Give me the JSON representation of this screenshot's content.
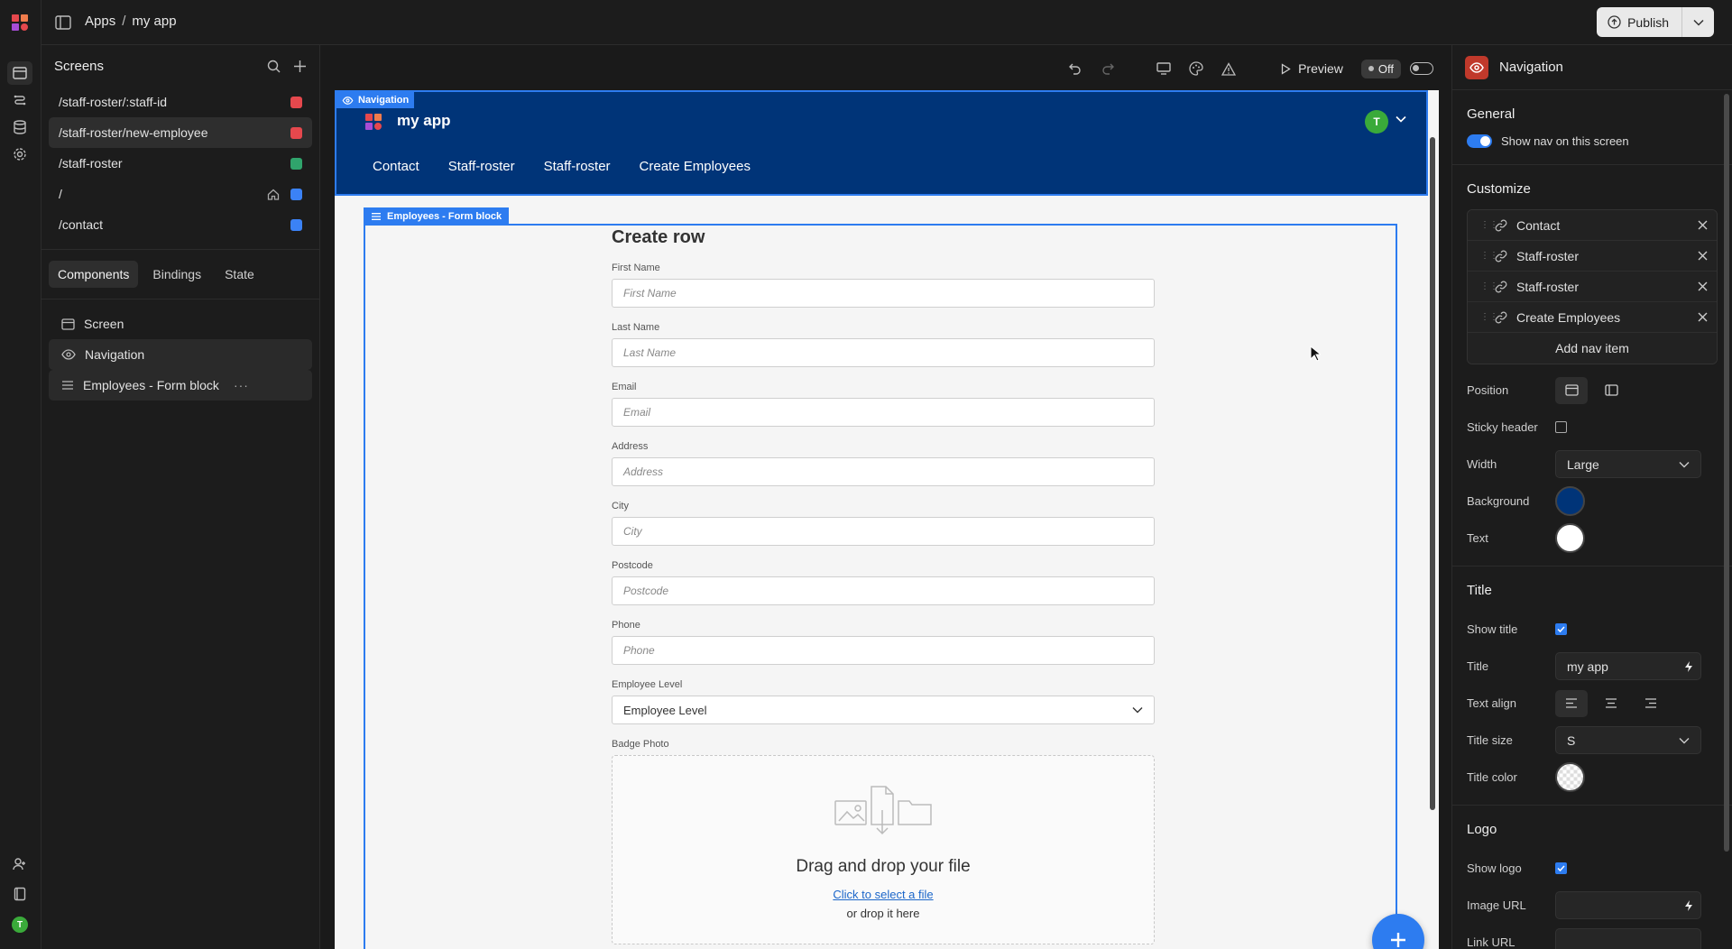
{
  "topbar": {
    "crumb_root": "Apps",
    "crumb_sep": "/",
    "crumb_app": "my app",
    "publish_label": "Publish"
  },
  "screens_panel": {
    "title": "Screens",
    "screens": [
      {
        "route": "/staff-roster/:staff-id",
        "color": "#e5484d",
        "selected": false,
        "home": false
      },
      {
        "route": "/staff-roster/new-employee",
        "color": "#e5484d",
        "selected": true,
        "home": false
      },
      {
        "route": "/staff-roster",
        "color": "#30a46c",
        "selected": false,
        "home": false
      },
      {
        "route": "/",
        "color": "#3b82f6",
        "selected": false,
        "home": true
      },
      {
        "route": "/contact",
        "color": "#3b82f6",
        "selected": false,
        "home": false
      }
    ],
    "tabs": [
      "Components",
      "Bindings",
      "State"
    ],
    "active_tab": "Components",
    "tree": [
      {
        "label": "Screen",
        "icon": "screen-icon"
      },
      {
        "label": "Navigation",
        "icon": "eye-icon"
      },
      {
        "label": "Employees - Form block",
        "icon": "form-icon"
      }
    ]
  },
  "canvas_toolbar": {
    "preview_label": "Preview",
    "off_label": "Off"
  },
  "preview": {
    "nav_tag": "Navigation",
    "app_title": "my app",
    "avatar_initial": "T",
    "nav_links": [
      "Contact",
      "Staff-roster",
      "Staff-roster",
      "Create Employees"
    ],
    "nav_background": "#003478",
    "form_tag": "Employees - Form block",
    "form_title": "Create row",
    "fields": [
      {
        "label": "First Name",
        "placeholder": "First Name"
      },
      {
        "label": "Last Name",
        "placeholder": "Last Name"
      },
      {
        "label": "Email",
        "placeholder": "Email"
      },
      {
        "label": "Address",
        "placeholder": "Address"
      },
      {
        "label": "City",
        "placeholder": "City"
      },
      {
        "label": "Postcode",
        "placeholder": "Postcode"
      },
      {
        "label": "Phone",
        "placeholder": "Phone"
      }
    ],
    "select_field": {
      "label": "Employee Level",
      "value": "Employee Level"
    },
    "upload_field": {
      "label": "Badge Photo",
      "title": "Drag and drop your file",
      "link": "Click to select a file",
      "or_text": "or drop it here"
    }
  },
  "settings_panel": {
    "title": "Navigation",
    "general": {
      "heading": "General",
      "show_nav_label": "Show nav on this screen",
      "show_nav_on": true
    },
    "customize": {
      "heading": "Customize",
      "nav_items": [
        "Contact",
        "Staff-roster",
        "Staff-roster",
        "Create Employees"
      ],
      "add_label": "Add nav item",
      "position_label": "Position",
      "sticky_label": "Sticky header",
      "sticky_on": false,
      "width_label": "Width",
      "width_value": "Large",
      "background_label": "Background",
      "background_color": "#003478",
      "text_label": "Text",
      "text_color": "#ffffff"
    },
    "title_section": {
      "heading": "Title",
      "show_title_label": "Show title",
      "show_title_on": true,
      "title_label": "Title",
      "title_value": "my app",
      "align_label": "Text align",
      "size_label": "Title size",
      "size_value": "S",
      "color_label": "Title color"
    },
    "logo_section": {
      "heading": "Logo",
      "show_logo_label": "Show logo",
      "show_logo_on": true,
      "image_url_label": "Image URL",
      "image_url_value": "",
      "link_url_label": "Link URL"
    }
  }
}
